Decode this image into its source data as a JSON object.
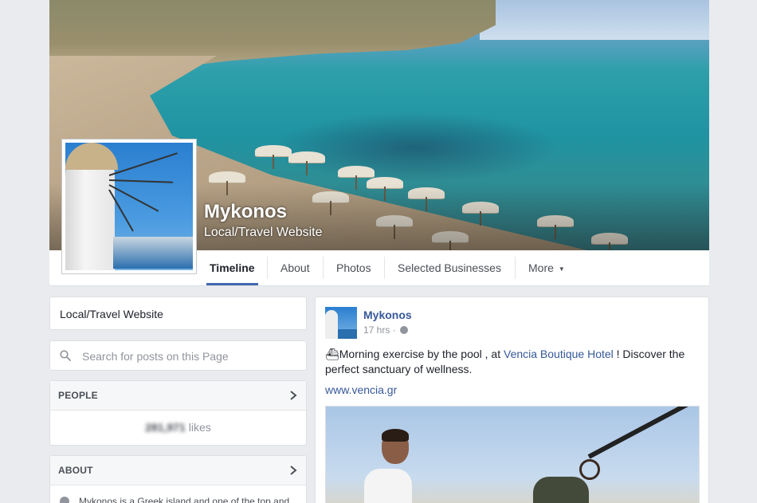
{
  "page": {
    "name": "Mykonos",
    "category": "Local/Travel Website"
  },
  "nav": {
    "tabs": [
      {
        "label": "Timeline"
      },
      {
        "label": "About"
      },
      {
        "label": "Photos"
      },
      {
        "label": "Selected Businesses"
      },
      {
        "label": "More"
      }
    ]
  },
  "sidebar": {
    "category": "Local/Travel Website",
    "search_placeholder": "Search for posts on this Page",
    "people": {
      "heading": "PEOPLE",
      "likes_count": "281,971",
      "likes_label": "likes"
    },
    "about": {
      "heading": "ABOUT",
      "text": "Mykonos is a Greek island and one of the top and"
    }
  },
  "post": {
    "author": "Mykonos",
    "time": "17 hrs",
    "text_before": "⛴Morning exercise by the pool , at ",
    "link_text": "Vencia Boutique Hotel",
    "text_after": " ! Discover the perfect sanctuary of wellness.",
    "url": "www.vencia.gr"
  },
  "colors": {
    "background": "#e9ebee",
    "link": "#365899",
    "accent": "#4267b2"
  },
  "icons": {
    "search": "search-icon",
    "chevron": "chevron-right-icon",
    "globe": "globe-icon",
    "caret": "caret-down-icon",
    "info": "info-icon"
  }
}
